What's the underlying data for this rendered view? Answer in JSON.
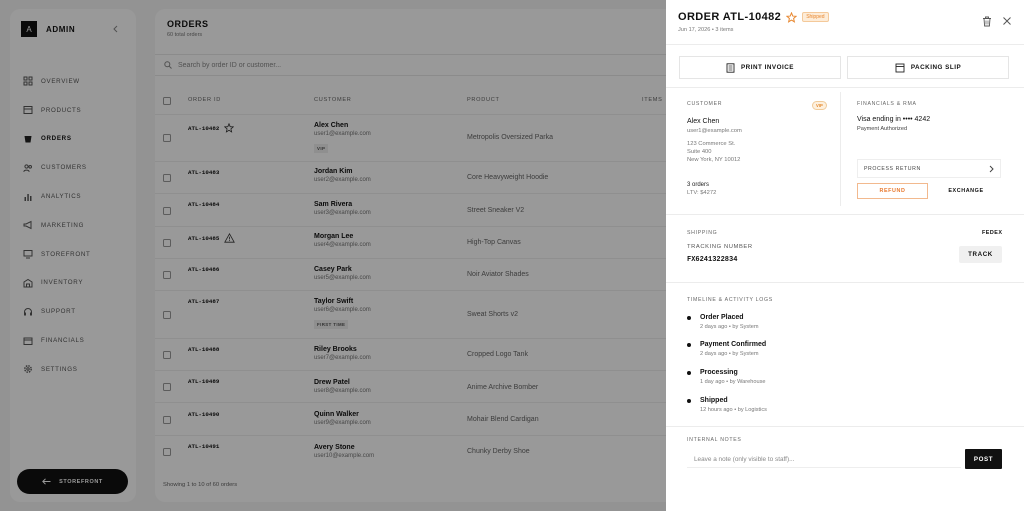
{
  "sidebar": {
    "brand_letter": "A",
    "brand_name": "ADMIN",
    "items": [
      {
        "label": "OVERVIEW",
        "icon": "grid-icon"
      },
      {
        "label": "PRODUCTS",
        "icon": "box-icon"
      },
      {
        "label": "ORDERS",
        "icon": "cart-icon",
        "active": true
      },
      {
        "label": "CUSTOMERS",
        "icon": "users-icon"
      },
      {
        "label": "ANALYTICS",
        "icon": "bar-chart-icon"
      },
      {
        "label": "MARKETING",
        "icon": "megaphone-icon"
      },
      {
        "label": "STOREFRONT",
        "icon": "monitor-icon"
      },
      {
        "label": "INVENTORY",
        "icon": "warehouse-icon"
      },
      {
        "label": "SUPPORT",
        "icon": "headset-icon"
      },
      {
        "label": "FINANCIALS",
        "icon": "wallet-icon"
      },
      {
        "label": "SETTINGS",
        "icon": "gear-icon"
      }
    ],
    "storefront_button": "STOREFRONT"
  },
  "main": {
    "title": "ORDERS",
    "subtitle": "60 total orders",
    "search_placeholder": "Search by order ID or customer...",
    "columns": [
      "ORDER ID",
      "CUSTOMER",
      "PRODUCT",
      "ITEMS"
    ],
    "rows": [
      {
        "id": "ATL-10482",
        "star": true,
        "name": "Alex Chen",
        "email": "user1@example.com",
        "product": "Metropolis Oversized Parka",
        "badge": "VIP"
      },
      {
        "id": "ATL-10483",
        "name": "Jordan Kim",
        "email": "user2@example.com",
        "product": "Core Heavyweight Hoodie"
      },
      {
        "id": "ATL-10484",
        "name": "Sam Rivera",
        "email": "user3@example.com",
        "product": "Street Sneaker V2"
      },
      {
        "id": "ATL-10485",
        "warning": true,
        "name": "Morgan Lee",
        "email": "user4@example.com",
        "product": "High-Top Canvas"
      },
      {
        "id": "ATL-10486",
        "name": "Casey Park",
        "email": "user5@example.com",
        "product": "Noir Aviator Shades"
      },
      {
        "id": "ATL-10487",
        "name": "Taylor Swift",
        "email": "user6@example.com",
        "product": "Sweat Shorts v2",
        "badge": "FIRST TIME"
      },
      {
        "id": "ATL-10488",
        "name": "Riley Brooks",
        "email": "user7@example.com",
        "product": "Cropped Logo Tank"
      },
      {
        "id": "ATL-10489",
        "name": "Drew Patel",
        "email": "user8@example.com",
        "product": "Anime Archive Bomber"
      },
      {
        "id": "ATL-10490",
        "name": "Quinn Walker",
        "email": "user9@example.com",
        "product": "Mohair Blend Cardigan"
      },
      {
        "id": "ATL-10491",
        "name": "Avery Stone",
        "email": "user10@example.com",
        "product": "Chunky Derby Shoe"
      }
    ],
    "footer": "Showing 1 to 10 of 60 orders"
  },
  "drawer": {
    "title": "ORDER ATL-10482",
    "status": "Shipped",
    "subtitle": "Jun 17, 2026 • 3 items",
    "print_invoice": "PRINT INVOICE",
    "packing_slip": "PACKING SLIP",
    "customer": {
      "label": "CUSTOMER",
      "vip": "VIP",
      "name": "Alex Chen",
      "email": "user1@example.com",
      "address1": "123 Commerce St.",
      "address2": "Suite 400",
      "address3": "New York, NY 10012",
      "orders": "3 orders",
      "ltv": "LTV: $4272"
    },
    "financials": {
      "label": "FINANCIALS & RMA",
      "card": "Visa ending in •••• 4242",
      "payment_status": "Payment Authorized",
      "process_return": "PROCESS RETURN",
      "refund": "REFUND",
      "exchange": "EXCHANGE"
    },
    "shipping": {
      "label": "SHIPPING",
      "carrier": "FEDEX",
      "tracking_label": "TRACKING NUMBER",
      "tracking_number": "FX6241322834",
      "track_button": "TRACK"
    },
    "timeline": {
      "label": "TIMELINE & ACTIVITY LOGS",
      "events": [
        {
          "title": "Order Placed",
          "meta": "2 days ago • by System"
        },
        {
          "title": "Payment Confirmed",
          "meta": "2 days ago • by System"
        },
        {
          "title": "Processing",
          "meta": "1 day ago • by Warehouse"
        },
        {
          "title": "Shipped",
          "meta": "12 hours ago • by Logistics"
        }
      ]
    },
    "notes": {
      "label": "INTERNAL NOTES",
      "placeholder": "Leave a note (only visible to staff)...",
      "post": "POST"
    }
  },
  "colors": {
    "accent": "#e8872f",
    "dark": "#111111",
    "overlay": "rgba(0,0,0,0.4)"
  }
}
